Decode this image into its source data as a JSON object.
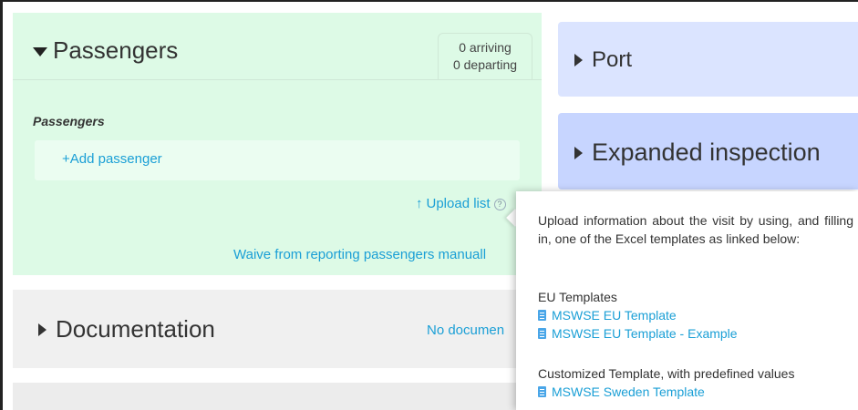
{
  "passengers": {
    "title": "Passengers",
    "counts": {
      "arriving": "0 arriving",
      "departing": "0 departing"
    },
    "section_label": "Passengers",
    "add_label": "+Add passenger",
    "upload_label": "Upload list",
    "help_glyph": "?",
    "waive_label": "Waive from reporting passengers manuall"
  },
  "documentation": {
    "title": "Documentation",
    "status": "No documen"
  },
  "port": {
    "title": "Port"
  },
  "expanded_inspection": {
    "title": "Expanded inspection"
  },
  "tooltip": {
    "intro": "Upload information about the visit by using, and filling in, one of the Excel templates as linked below:",
    "eu_heading": "EU Templates",
    "eu_links": [
      "MSWSE EU Template",
      "MSWSE EU Template - Example"
    ],
    "custom_heading": "Customized Template, with predefined values",
    "custom_links": [
      "MSWSE Sweden Template"
    ]
  },
  "colors": {
    "passengers_bg": "#ddfae6",
    "link": "#1a9fd6",
    "port_bg": "#dbe4ff",
    "expanded_bg": "#c7d5ff",
    "documentation_bg": "#f0f0f0"
  },
  "icons": [
    "caret-down-icon",
    "caret-right-icon",
    "upload-arrow-icon",
    "help-icon",
    "document-icon"
  ]
}
